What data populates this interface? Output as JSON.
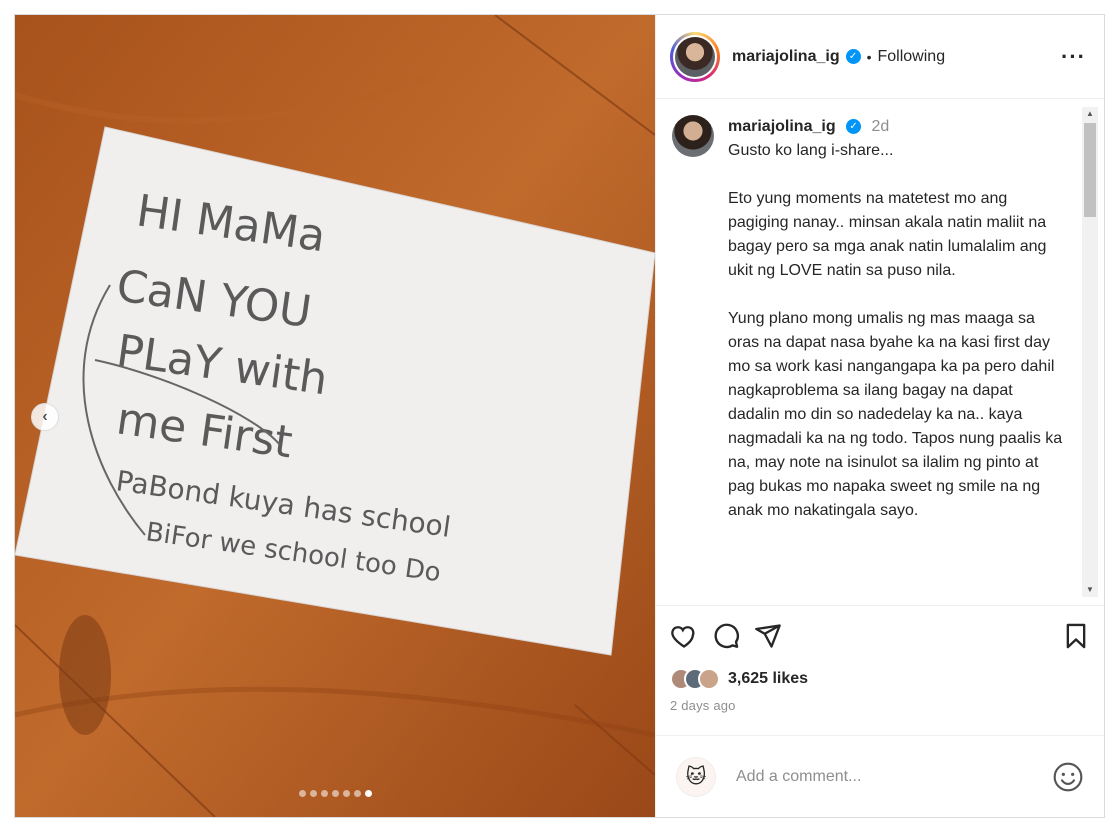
{
  "post": {
    "username": "mariajolina_ig",
    "follow_status": "Following",
    "more_icon": "more-horizontal-icon",
    "caption": {
      "username": "mariajolina_ig",
      "time_ago": "2d",
      "paragraphs": [
        "Gusto ko lang i-share...",
        "Eto yung moments na matetest mo ang pagiging nanay.. minsan akala natin maliit na bagay pero sa mga anak natin lumalalim ang ukit ng LOVE natin sa puso nila.",
        "Yung plano mong umalis ng mas maaga sa oras na dapat nasa byahe ka na kasi first day mo sa work kasi nangangapa ka pa pero dahil nagkaproblema sa ilang bagay na dapat dadalin mo din so nadedelay ka na.. kaya nagmadali ka na ng todo. Tapos nung paalis ka na, may note na isinulot sa ilalim ng pinto at pag bukas mo napaka sweet ng smile na ng anak mo nakatingala sayo."
      ]
    },
    "likes": "3,625 likes",
    "time": "2 days ago",
    "comment_placeholder": "Add a comment...",
    "carousel": {
      "count": 7,
      "active_index": 6
    },
    "note_text": {
      "line1": "HI MaMa",
      "line2": "CaN YOU",
      "line3": "PLaY with",
      "line4": "me First",
      "line5": "PaBond kuya has school",
      "line6": "BiFor we school too Do"
    }
  }
}
